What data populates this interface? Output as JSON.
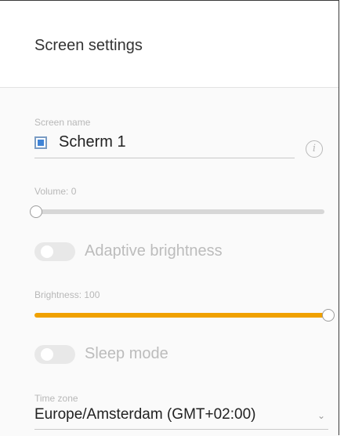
{
  "header": {
    "title": "Screen settings"
  },
  "screen_name": {
    "label": "Screen name",
    "value": "Scherm 1",
    "swatch_color": "#3f83d6",
    "info_icon": "info-icon",
    "info_glyph": "i"
  },
  "volume": {
    "label": "Volume: 0",
    "value": 0
  },
  "adaptive_brightness": {
    "label": "Adaptive brightness",
    "enabled": false
  },
  "brightness": {
    "label": "Brightness: 100",
    "value": 100,
    "accent_color": "#f0a100"
  },
  "sleep_mode": {
    "label": "Sleep mode",
    "enabled": false
  },
  "time_zone": {
    "label": "Time zone",
    "value": "Europe/Amsterdam (GMT+02:00)",
    "chevron_icon": "chevron-down-icon",
    "chevron_glyph": "⌄"
  }
}
